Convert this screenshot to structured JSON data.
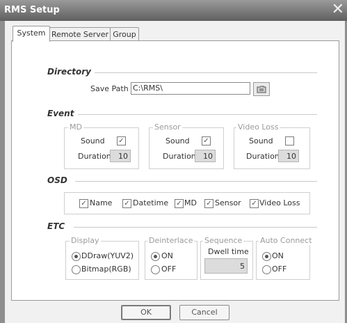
{
  "window": {
    "title": "RMS Setup",
    "close_glyph": "✕"
  },
  "tabs": [
    {
      "label": "System",
      "active": true
    },
    {
      "label": "Remote Server",
      "active": false
    },
    {
      "label": "Group",
      "active": false
    }
  ],
  "directory": {
    "title": "Directory",
    "save_path_label": "Save Path",
    "save_path_value": "C:\\RMS\\",
    "browse_icon": "folder-browse-icon"
  },
  "event": {
    "title": "Event",
    "groups": [
      {
        "label": "MD",
        "sound_label": "Sound",
        "sound_checked": true,
        "duration_label": "Duration",
        "duration_value": "10"
      },
      {
        "label": "Sensor",
        "sound_label": "Sound",
        "sound_checked": true,
        "duration_label": "Duration",
        "duration_value": "10"
      },
      {
        "label": "Video Loss",
        "sound_label": "Sound",
        "sound_checked": false,
        "duration_label": "Duration",
        "duration_value": "10"
      }
    ]
  },
  "osd": {
    "title": "OSD",
    "items": [
      {
        "label": "Name",
        "checked": true
      },
      {
        "label": "Datetime",
        "checked": true
      },
      {
        "label": "MD",
        "checked": true
      },
      {
        "label": "Sensor",
        "checked": true
      },
      {
        "label": "Video Loss",
        "checked": true
      }
    ]
  },
  "etc": {
    "title": "ETC",
    "display": {
      "label": "Display",
      "options": [
        {
          "label": "DDraw(YUV2)",
          "selected": true
        },
        {
          "label": "Bitmap(RGB)",
          "selected": false
        }
      ]
    },
    "deinterlace": {
      "label": "Deinterlace",
      "options": [
        {
          "label": "ON",
          "selected": true
        },
        {
          "label": "OFF",
          "selected": false
        }
      ]
    },
    "sequence": {
      "label": "Sequence",
      "dwell_label": "Dwell time",
      "dwell_value": "5"
    },
    "auto_connect": {
      "label": "Auto Connect",
      "options": [
        {
          "label": "ON",
          "selected": true
        },
        {
          "label": "OFF",
          "selected": false
        }
      ]
    }
  },
  "buttons": {
    "ok": "OK",
    "cancel": "Cancel"
  },
  "check_glyph": "✓",
  "colors": {
    "titlebar": "#7a7a7a",
    "panel": "#ffffff",
    "frame": "#f1f1f1"
  }
}
